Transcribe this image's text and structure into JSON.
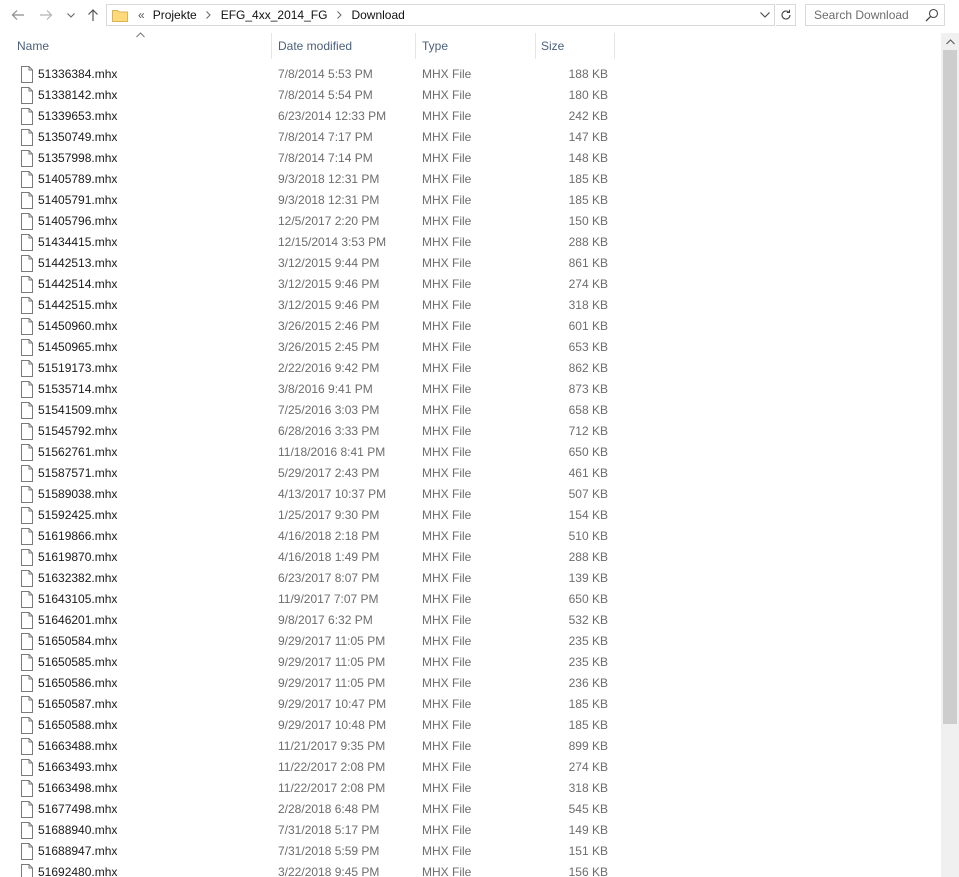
{
  "navigation": {
    "back_icon": "back-arrow-icon",
    "forward_icon": "forward-arrow-icon",
    "recent_icon": "chevron-down-icon",
    "up_icon": "up-arrow-icon"
  },
  "address": {
    "overflow": "«",
    "crumbs": [
      "Projekte",
      "EFG_4xx_2014_FG",
      "Download"
    ]
  },
  "search": {
    "placeholder": "Search Download"
  },
  "columns": {
    "name": "Name",
    "date": "Date modified",
    "type": "Type",
    "size": "Size"
  },
  "files": [
    {
      "name": "51336384.mhx",
      "date": "7/8/2014 5:53 PM",
      "type": "MHX File",
      "size": "188 KB"
    },
    {
      "name": "51338142.mhx",
      "date": "7/8/2014 5:54 PM",
      "type": "MHX File",
      "size": "180 KB"
    },
    {
      "name": "51339653.mhx",
      "date": "6/23/2014 12:33 PM",
      "type": "MHX File",
      "size": "242 KB"
    },
    {
      "name": "51350749.mhx",
      "date": "7/8/2014 7:17 PM",
      "type": "MHX File",
      "size": "147 KB"
    },
    {
      "name": "51357998.mhx",
      "date": "7/8/2014 7:14 PM",
      "type": "MHX File",
      "size": "148 KB"
    },
    {
      "name": "51405789.mhx",
      "date": "9/3/2018 12:31 PM",
      "type": "MHX File",
      "size": "185 KB"
    },
    {
      "name": "51405791.mhx",
      "date": "9/3/2018 12:31 PM",
      "type": "MHX File",
      "size": "185 KB"
    },
    {
      "name": "51405796.mhx",
      "date": "12/5/2017 2:20 PM",
      "type": "MHX File",
      "size": "150 KB"
    },
    {
      "name": "51434415.mhx",
      "date": "12/15/2014 3:53 PM",
      "type": "MHX File",
      "size": "288 KB"
    },
    {
      "name": "51442513.mhx",
      "date": "3/12/2015 9:44 PM",
      "type": "MHX File",
      "size": "861 KB"
    },
    {
      "name": "51442514.mhx",
      "date": "3/12/2015 9:46 PM",
      "type": "MHX File",
      "size": "274 KB"
    },
    {
      "name": "51442515.mhx",
      "date": "3/12/2015 9:46 PM",
      "type": "MHX File",
      "size": "318 KB"
    },
    {
      "name": "51450960.mhx",
      "date": "3/26/2015 2:46 PM",
      "type": "MHX File",
      "size": "601 KB"
    },
    {
      "name": "51450965.mhx",
      "date": "3/26/2015 2:45 PM",
      "type": "MHX File",
      "size": "653 KB"
    },
    {
      "name": "51519173.mhx",
      "date": "2/22/2016 9:42 PM",
      "type": "MHX File",
      "size": "862 KB"
    },
    {
      "name": "51535714.mhx",
      "date": "3/8/2016 9:41 PM",
      "type": "MHX File",
      "size": "873 KB"
    },
    {
      "name": "51541509.mhx",
      "date": "7/25/2016 3:03 PM",
      "type": "MHX File",
      "size": "658 KB"
    },
    {
      "name": "51545792.mhx",
      "date": "6/28/2016 3:33 PM",
      "type": "MHX File",
      "size": "712 KB"
    },
    {
      "name": "51562761.mhx",
      "date": "11/18/2016 8:41 PM",
      "type": "MHX File",
      "size": "650 KB"
    },
    {
      "name": "51587571.mhx",
      "date": "5/29/2017 2:43 PM",
      "type": "MHX File",
      "size": "461 KB"
    },
    {
      "name": "51589038.mhx",
      "date": "4/13/2017 10:37 PM",
      "type": "MHX File",
      "size": "507 KB"
    },
    {
      "name": "51592425.mhx",
      "date": "1/25/2017 9:30 PM",
      "type": "MHX File",
      "size": "154 KB"
    },
    {
      "name": "51619866.mhx",
      "date": "4/16/2018 2:18 PM",
      "type": "MHX File",
      "size": "510 KB"
    },
    {
      "name": "51619870.mhx",
      "date": "4/16/2018 1:49 PM",
      "type": "MHX File",
      "size": "288 KB"
    },
    {
      "name": "51632382.mhx",
      "date": "6/23/2017 8:07 PM",
      "type": "MHX File",
      "size": "139 KB"
    },
    {
      "name": "51643105.mhx",
      "date": "11/9/2017 7:07 PM",
      "type": "MHX File",
      "size": "650 KB"
    },
    {
      "name": "51646201.mhx",
      "date": "9/8/2017 6:32 PM",
      "type": "MHX File",
      "size": "532 KB"
    },
    {
      "name": "51650584.mhx",
      "date": "9/29/2017 11:05 PM",
      "type": "MHX File",
      "size": "235 KB"
    },
    {
      "name": "51650585.mhx",
      "date": "9/29/2017 11:05 PM",
      "type": "MHX File",
      "size": "235 KB"
    },
    {
      "name": "51650586.mhx",
      "date": "9/29/2017 11:05 PM",
      "type": "MHX File",
      "size": "236 KB"
    },
    {
      "name": "51650587.mhx",
      "date": "9/29/2017 10:47 PM",
      "type": "MHX File",
      "size": "185 KB"
    },
    {
      "name": "51650588.mhx",
      "date": "9/29/2017 10:48 PM",
      "type": "MHX File",
      "size": "185 KB"
    },
    {
      "name": "51663488.mhx",
      "date": "11/21/2017 9:35 PM",
      "type": "MHX File",
      "size": "899 KB"
    },
    {
      "name": "51663493.mhx",
      "date": "11/22/2017 2:08 PM",
      "type": "MHX File",
      "size": "274 KB"
    },
    {
      "name": "51663498.mhx",
      "date": "11/22/2017 2:08 PM",
      "type": "MHX File",
      "size": "318 KB"
    },
    {
      "name": "51677498.mhx",
      "date": "2/28/2018 6:48 PM",
      "type": "MHX File",
      "size": "545 KB"
    },
    {
      "name": "51688940.mhx",
      "date": "7/31/2018 5:17 PM",
      "type": "MHX File",
      "size": "149 KB"
    },
    {
      "name": "51688947.mhx",
      "date": "7/31/2018 5:59 PM",
      "type": "MHX File",
      "size": "151 KB"
    },
    {
      "name": "51692480.mhx",
      "date": "3/22/2018 9:45 PM",
      "type": "MHX File",
      "size": "156 KB"
    }
  ],
  "colors": {
    "folder": "#ffd97a",
    "header_text": "#4c607a",
    "scroll_thumb": "#cdcdcd"
  }
}
